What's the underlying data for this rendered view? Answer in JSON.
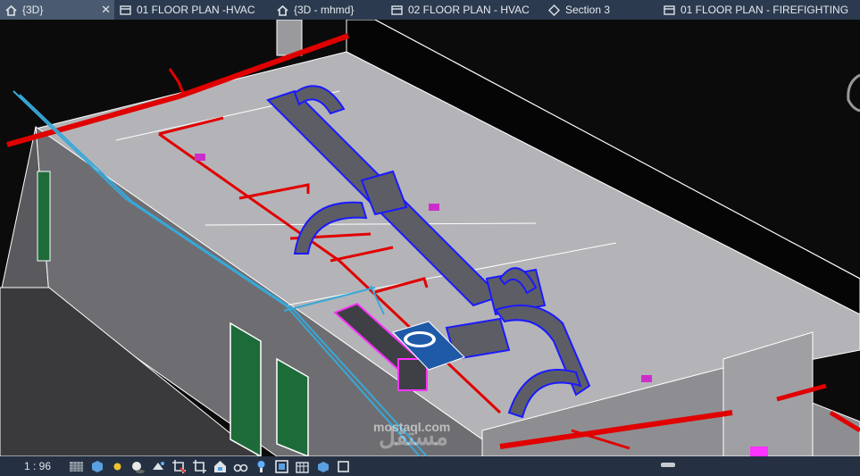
{
  "tabs": [
    {
      "label": "{3D}",
      "icon": "home-icon",
      "active": true,
      "closable": true
    },
    {
      "label": "01 FLOOR PLAN -HVAC",
      "icon": "floor-plan-icon"
    },
    {
      "label": "{3D - mhmd}",
      "icon": "home-icon"
    },
    {
      "label": "02 FLOOR PLAN - HVAC",
      "icon": "floor-plan-icon"
    },
    {
      "label": "Section 3",
      "icon": "section-icon"
    },
    {
      "label": "01 FLOOR PLAN - FIREFIGHTING",
      "icon": "floor-plan-icon"
    }
  ],
  "status": {
    "scale": "1 : 96",
    "icons": [
      "detail-level-icon",
      "visual-style-icon",
      "sun-path-icon",
      "shadows-icon",
      "render-icon",
      "crop-view-icon",
      "hide-crop-icon",
      "unlock-3d-icon",
      "temporary-hide-icon",
      "reveal-hidden-icon",
      "worksharing-icon",
      "analytical-model-icon",
      "highlight-displacement-icon",
      "reveal-constraints-icon"
    ]
  },
  "watermark": {
    "latin": "mostaql.com",
    "arabic": "مستقل"
  },
  "colors": {
    "fire_pipe": "#e00000",
    "duct": "#5d5d66",
    "duct_edge": "#1a1aff",
    "water_pipe": "#38a8d8",
    "roof": "#b4b4b8",
    "fan_unit": "#ff33ff"
  }
}
